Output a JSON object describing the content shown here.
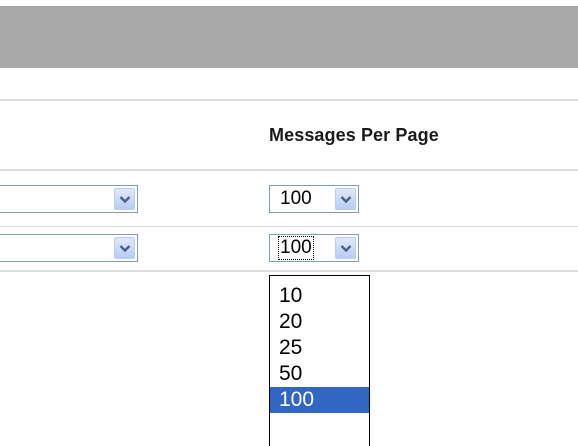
{
  "table": {
    "column_header": "Messages Per Page"
  },
  "rows": [
    {
      "messages_per_page": "100"
    },
    {
      "messages_per_page": "100"
    }
  ],
  "dropdown": {
    "options": [
      "10",
      "20",
      "25",
      "50",
      "100"
    ],
    "selected": "100"
  },
  "icons": {
    "dropdown_arrow": "chevron-down-icon"
  },
  "colors": {
    "header_bar": "#a8a8a8",
    "select_border": "#7f9db9",
    "selected_option_bg": "#3166c4",
    "arrow_glyph": "#4d6185"
  }
}
